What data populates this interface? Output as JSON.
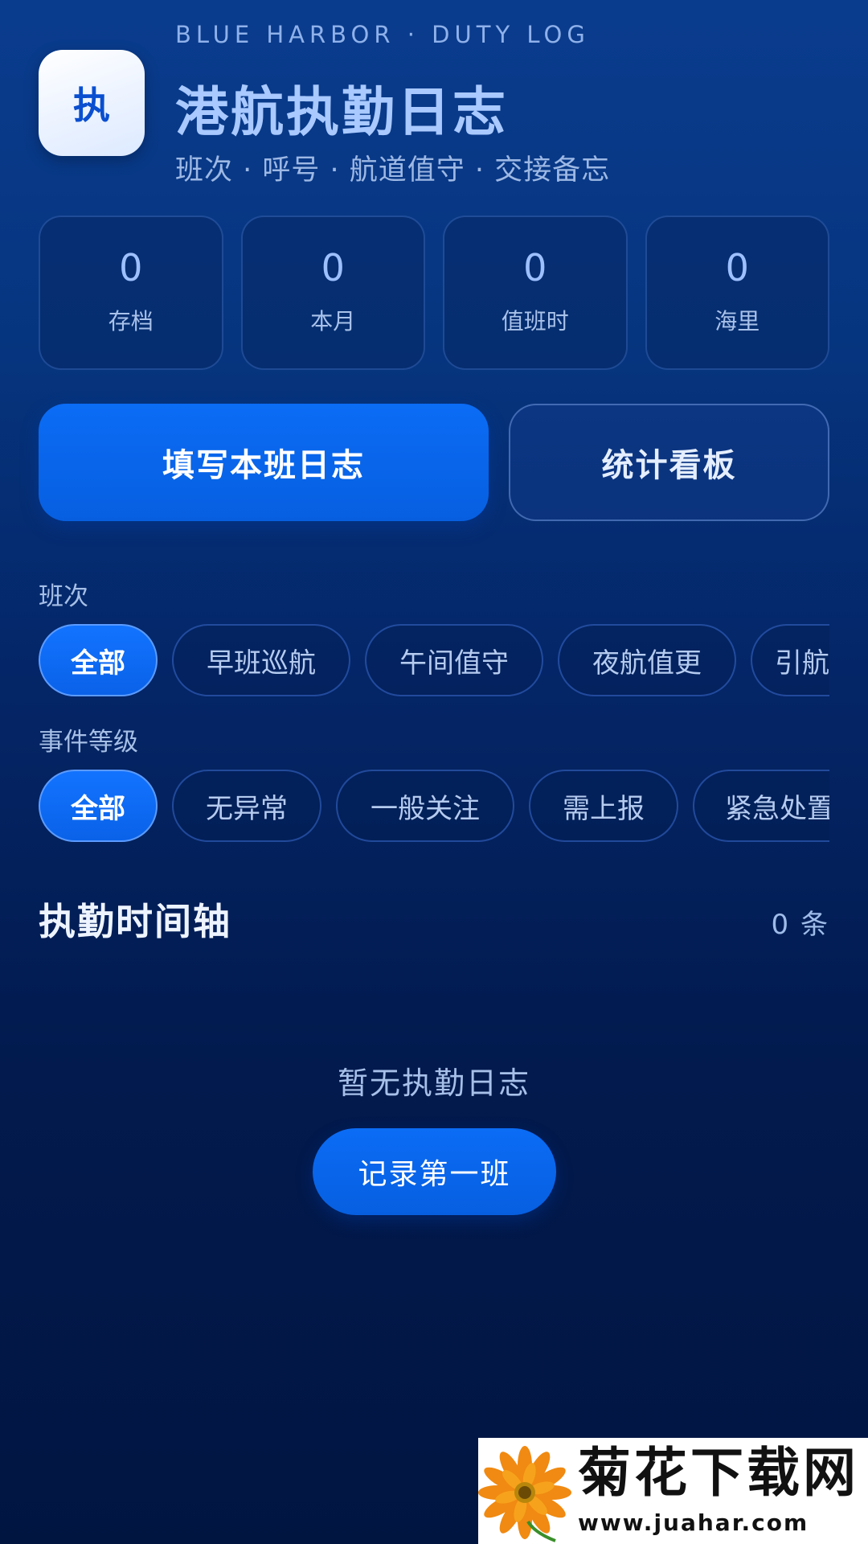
{
  "header": {
    "icon_char": "执",
    "brand_en": "BLUE HARBOR · DUTY LOG",
    "title": "港航执勤日志",
    "subtitle": "班次 · 呼号 · 航道值守 · 交接备忘"
  },
  "stats": [
    {
      "value": "0",
      "label": "存档"
    },
    {
      "value": "0",
      "label": "本月"
    },
    {
      "value": "0",
      "label": "值班时"
    },
    {
      "value": "0",
      "label": "海里"
    }
  ],
  "actions": {
    "primary_label": "填写本班日志",
    "secondary_label": "统计看板"
  },
  "filters": {
    "shift": {
      "label": "班次",
      "options": [
        "全部",
        "早班巡航",
        "午间值守",
        "夜航值更",
        "引航"
      ],
      "selected": "全部"
    },
    "level": {
      "label": "事件等级",
      "options": [
        "全部",
        "无异常",
        "一般关注",
        "需上报",
        "紧急处置"
      ],
      "selected": "全部"
    }
  },
  "timeline": {
    "title": "执勤时间轴",
    "count": "0 条",
    "empty_text": "暂无执勤日志",
    "empty_button": "记录第一班"
  },
  "watermark": {
    "title": "菊花下载网",
    "url": "www.juahar.com"
  },
  "colors": {
    "accent": "#0B6CF5",
    "background_top": "#0A3C8E",
    "background_bottom": "#011541"
  }
}
